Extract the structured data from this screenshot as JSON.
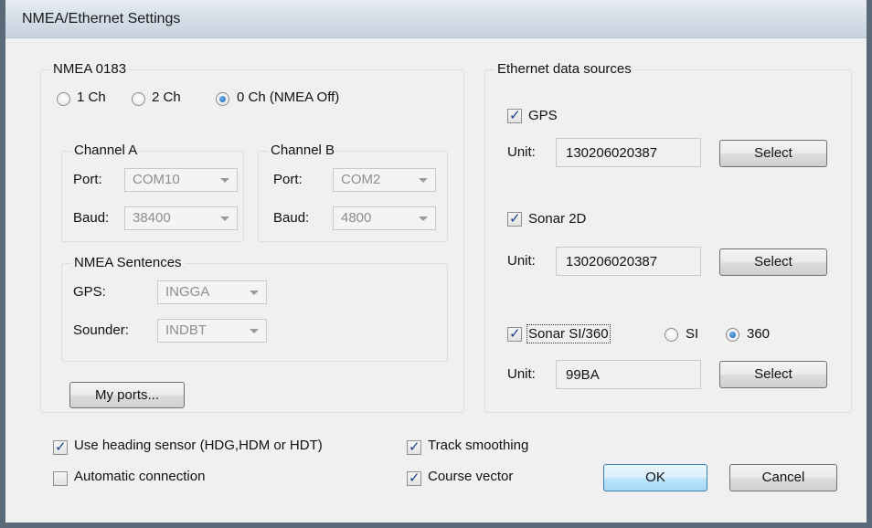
{
  "window": {
    "title": "NMEA/Ethernet Settings"
  },
  "nmea": {
    "group_label": "NMEA 0183",
    "channel_options": [
      "1 Ch",
      "2 Ch",
      "0 Ch (NMEA Off)"
    ],
    "selected_channel_option": "0 Ch (NMEA Off)",
    "channel_a": {
      "label": "Channel A",
      "port_label": "Port:",
      "port_value": "COM10",
      "baud_label": "Baud:",
      "baud_value": "38400"
    },
    "channel_b": {
      "label": "Channel B",
      "port_label": "Port:",
      "port_value": "COM2",
      "baud_label": "Baud:",
      "baud_value": "4800"
    },
    "sentences": {
      "label": "NMEA Sentences",
      "gps_label": "GPS:",
      "gps_value": "INGGA",
      "sounder_label": "Sounder:",
      "sounder_value": "INDBT"
    },
    "my_ports_button": "My ports..."
  },
  "ethernet": {
    "group_label": "Ethernet data sources",
    "gps": {
      "label": "GPS",
      "checked": true,
      "unit_label": "Unit:",
      "unit_value": "130206020387",
      "select_button": "Select"
    },
    "sonar2d": {
      "label": "Sonar 2D",
      "checked": true,
      "unit_label": "Unit:",
      "unit_value": "130206020387",
      "select_button": "Select"
    },
    "sonar_si360": {
      "label": "Sonar SI/360",
      "checked": true,
      "options": [
        "SI",
        "360"
      ],
      "selected_option": "360",
      "unit_label": "Unit:",
      "unit_value": "99BA",
      "select_button": "Select"
    }
  },
  "options": {
    "use_heading_sensor": {
      "label": "Use heading sensor (HDG,HDM or HDT)",
      "checked": true
    },
    "automatic_connection": {
      "label": "Automatic connection",
      "checked": false
    },
    "track_smoothing": {
      "label": "Track smoothing",
      "checked": true
    },
    "course_vector": {
      "label": "Course vector",
      "checked": true
    }
  },
  "buttons": {
    "ok": "OK",
    "cancel": "Cancel"
  }
}
